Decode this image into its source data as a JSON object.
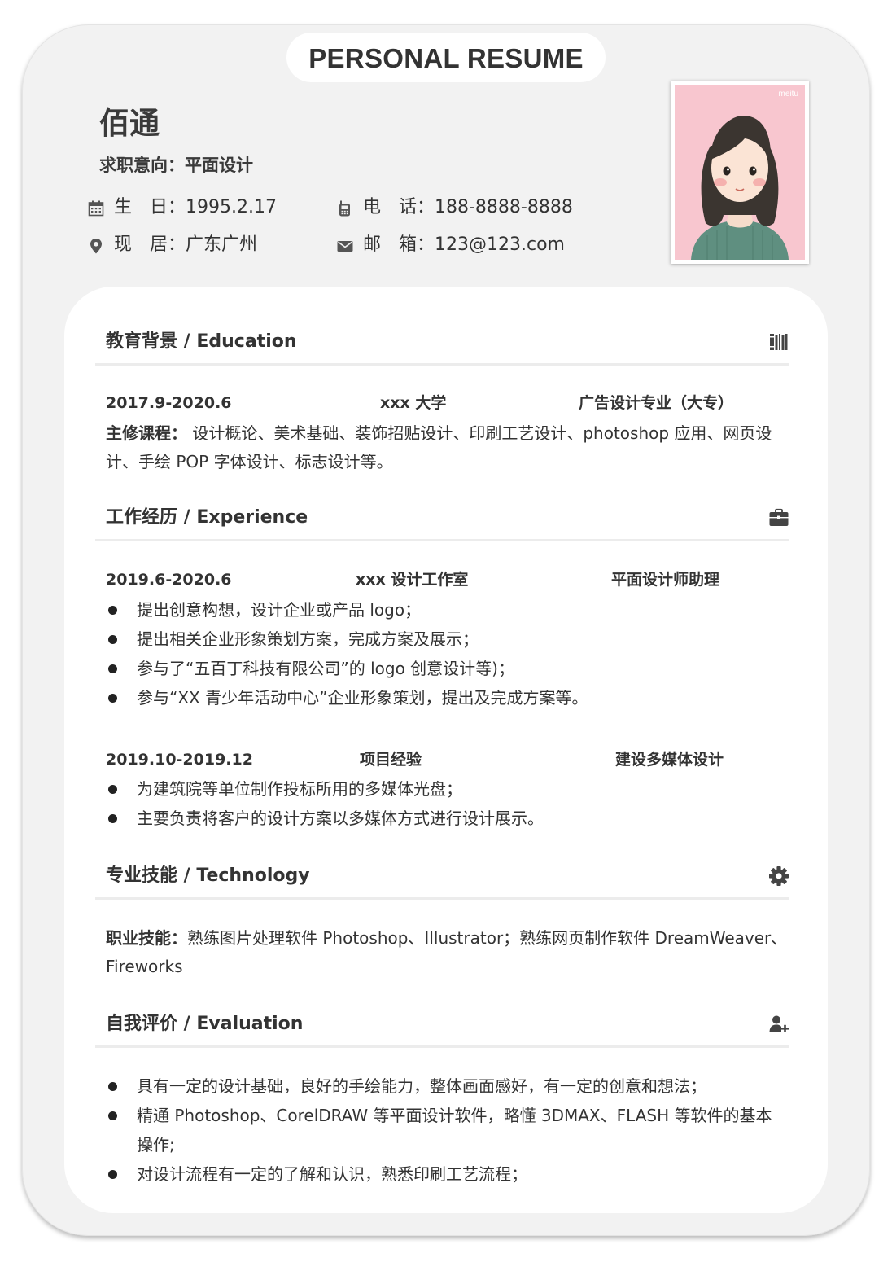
{
  "header": {
    "title": "PERSONAL RESUME",
    "name": "佰通",
    "intent": "求职意向：平面设计",
    "info": [
      {
        "icon": "calendar-icon",
        "text": "生　日：1995.2.17"
      },
      {
        "icon": "phone-icon",
        "text": "电　话：188-8888-8888"
      },
      {
        "icon": "location-icon",
        "text": "现　居：广东广州"
      },
      {
        "icon": "mail-icon",
        "text": "邮　箱：123@123.com"
      }
    ],
    "photo_watermark": "meitu"
  },
  "education": {
    "title": "教育背景 / Education",
    "icon": "books-icon",
    "period": "2017.9-2020.6",
    "school": "xxx 大学",
    "major": "广告设计专业（大专）",
    "courses_label": "主修课程：",
    "courses": " 设计概论、美术基础、装饰招贴设计、印刷工艺设计、photoshop 应用、网页设计、手绘 POP 字体设计、标志设计等。"
  },
  "experience": {
    "title": "工作经历 / Experience",
    "icon": "briefcase-icon",
    "jobs": [
      {
        "period": "2019.6-2020.6",
        "org": "xxx 设计工作室",
        "role": "平面设计师助理",
        "items": [
          "提出创意构想，设计企业或产品 logo；",
          "提出相关企业形象策划方案，完成方案及展示；",
          "参与了“五百丁科技有限公司”的 logo 创意设计等)；",
          "参与“XX 青少年活动中心”企业形象策划，提出及完成方案等。"
        ]
      },
      {
        "period": "2019.10-2019.12",
        "org": "项目经验",
        "role": "建设多媒体设计",
        "items": [
          "为建筑院等单位制作投标所用的多媒体光盘；",
          "主要负责将客户的设计方案以多媒体方式进行设计展示。"
        ]
      }
    ]
  },
  "skills": {
    "title": "专业技能 / Technology",
    "icon": "gear-icon",
    "label": "职业技能：",
    "text": "熟练图片处理软件 Photoshop、Illustrator；熟练网页制作软件 DreamWeaver、Fireworks"
  },
  "evaluation": {
    "title": "自我评价 / Evaluation",
    "icon": "add-user-icon",
    "items": [
      "具有一定的设计基础，良好的手绘能力，整体画面感好，有一定的创意和想法；",
      "精通 Photoshop、CorelDRAW 等平面设计软件，略懂 3DMAX、FLASH 等软件的基本操作;",
      "对设计流程有一定的了解和认识，熟悉印刷工艺流程；"
    ]
  },
  "colors": {
    "frame": "#f2f2f2",
    "card": "#ffffff",
    "text": "#333333",
    "photo_bg": "#f8c6cf",
    "sweater": "#5f8f80"
  }
}
